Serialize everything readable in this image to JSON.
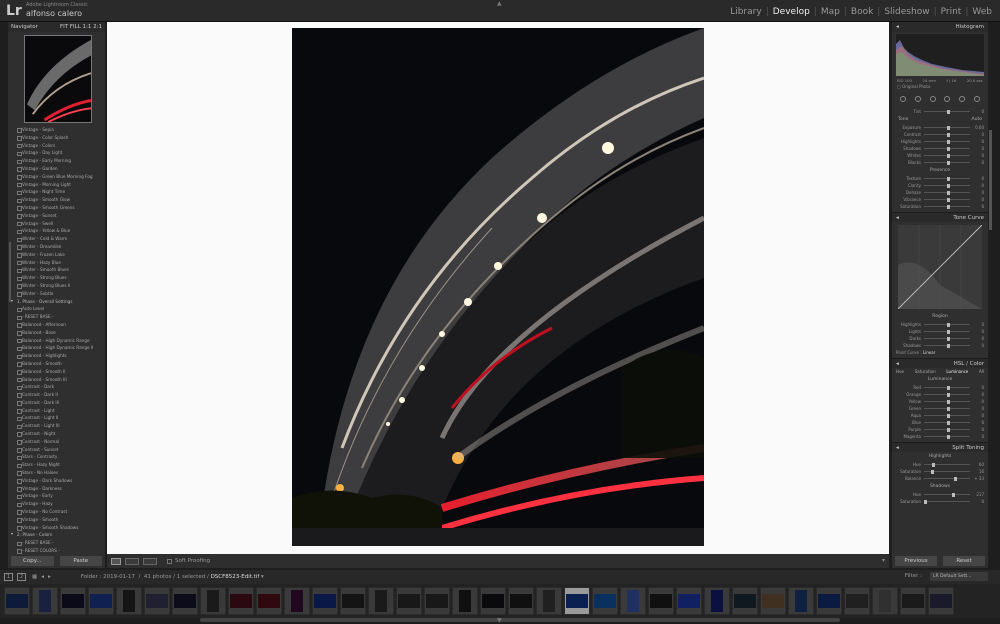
{
  "app": {
    "logo": "Lr",
    "name": "Adobe Lightroom Classic",
    "user": "alfonso calero"
  },
  "modules": [
    "Library",
    "Develop",
    "Map",
    "Book",
    "Slideshow",
    "Print",
    "Web"
  ],
  "active_module": "Develop",
  "navigator": {
    "title": "Navigator",
    "zoom_options": [
      "FIT",
      "FILL",
      "1:1",
      "2:1"
    ]
  },
  "presets": [
    {
      "label": "Vintage - Sepia",
      "group": false
    },
    {
      "label": "Vintage - Color Splash",
      "group": false
    },
    {
      "label": "Vintage - Colors",
      "group": false
    },
    {
      "label": "Vintage - Day Light",
      "group": false
    },
    {
      "label": "Vintage - Early Morning",
      "group": false
    },
    {
      "label": "Vintage - Garden",
      "group": false
    },
    {
      "label": "Vintage - Green Blue Morning Fog",
      "group": false
    },
    {
      "label": "Vintage - Morning Light",
      "group": false
    },
    {
      "label": "Vintage - Night Time",
      "group": false
    },
    {
      "label": "Vintage - Smooth Glow",
      "group": false
    },
    {
      "label": "Vintage - Smooth Greens",
      "group": false
    },
    {
      "label": "Vintage - Sunset",
      "group": false
    },
    {
      "label": "Vintage - Swell",
      "group": false
    },
    {
      "label": "Vintage - Yellow & Blue",
      "group": false
    },
    {
      "label": "Winter - Cold & Warm",
      "group": false
    },
    {
      "label": "Winter - Dreamlike",
      "group": false
    },
    {
      "label": "Winter - Frozen Lake",
      "group": false
    },
    {
      "label": "Winter - Hazy Blue",
      "group": false
    },
    {
      "label": "Winter - Smooth Blues",
      "group": false
    },
    {
      "label": "Winter - Strong Blues",
      "group": false
    },
    {
      "label": "Winter - Strong Blues II",
      "group": false
    },
    {
      "label": "Winter - Subtle",
      "group": false
    },
    {
      "label": "1. Phase - Overall Settings",
      "group": true
    },
    {
      "label": "Auto Level",
      "group": false
    },
    {
      "label": "- RESET BASE -",
      "group": false
    },
    {
      "label": "Balanced - Afternoon",
      "group": false
    },
    {
      "label": "Balanced - Base",
      "group": false
    },
    {
      "label": "Balanced - High Dynamic Range",
      "group": false
    },
    {
      "label": "Balanced - High Dynamic Range II",
      "group": false
    },
    {
      "label": "Balanced - Highlights",
      "group": false
    },
    {
      "label": "Balanced - Smooth",
      "group": false
    },
    {
      "label": "Balanced - Smooth II",
      "group": false
    },
    {
      "label": "Balanced - Smooth III",
      "group": false
    },
    {
      "label": "Contrast - Dark",
      "group": false
    },
    {
      "label": "Contrast - Dark II",
      "group": false
    },
    {
      "label": "Contrast - Dark III",
      "group": false
    },
    {
      "label": "Contrast - Light",
      "group": false
    },
    {
      "label": "Contrast - Light II",
      "group": false
    },
    {
      "label": "Contrast - Light III",
      "group": false
    },
    {
      "label": "Contrast - Night",
      "group": false
    },
    {
      "label": "Contrast - Normal",
      "group": false
    },
    {
      "label": "Contrast - Sunset",
      "group": false
    },
    {
      "label": "Stars - Contrasty",
      "group": false
    },
    {
      "label": "Stars - Hazy Night",
      "group": false
    },
    {
      "label": "Stars - No Haloes",
      "group": false
    },
    {
      "label": "Vintage - Dark Shadows",
      "group": false
    },
    {
      "label": "Vintage - Darkness",
      "group": false
    },
    {
      "label": "Vintage - Early",
      "group": false
    },
    {
      "label": "Vintage - Hazy",
      "group": false
    },
    {
      "label": "Vintage - No Contrast",
      "group": false
    },
    {
      "label": "Vintage - Smooth",
      "group": false
    },
    {
      "label": "Vintage - Smooth Shadows",
      "group": false
    },
    {
      "label": "2. Phase - Colors",
      "group": true
    },
    {
      "label": "- RESET BASE -",
      "group": false
    },
    {
      "label": "- RESET COLORS -",
      "group": false
    }
  ],
  "left_buttons": {
    "copy": "Copy...",
    "paste": "Paste"
  },
  "toolbar": {
    "soft_proofing": "Soft Proofing"
  },
  "right_panel": {
    "histogram_title": "Histogram",
    "histogram_meta": [
      "ISO 100",
      "24 mm",
      "f / 16",
      "20.0 sec"
    ],
    "original_photo": "Original Photo",
    "wb_label": "Tint",
    "tone_title": "Tone",
    "tone_auto": "Auto",
    "tone_sliders": [
      {
        "label": "Exposure",
        "value": "0.00",
        "pos": 0.5
      },
      {
        "label": "Contrast",
        "value": "0",
        "pos": 0.5
      },
      {
        "label": "Highlights",
        "value": "0",
        "pos": 0.5
      },
      {
        "label": "Shadows",
        "value": "0",
        "pos": 0.5
      },
      {
        "label": "Whites",
        "value": "0",
        "pos": 0.5
      },
      {
        "label": "Blacks",
        "value": "0",
        "pos": 0.5
      }
    ],
    "presence_title": "Presence",
    "presence_sliders": [
      {
        "label": "Texture",
        "value": "0",
        "pos": 0.5
      },
      {
        "label": "Clarity",
        "value": "0",
        "pos": 0.5
      },
      {
        "label": "Dehaze",
        "value": "0",
        "pos": 0.5
      },
      {
        "label": "Vibrance",
        "value": "0",
        "pos": 0.5
      },
      {
        "label": "Saturation",
        "value": "0",
        "pos": 0.5
      }
    ],
    "tone_curve_title": "Tone Curve",
    "region_title": "Region",
    "region_sliders": [
      {
        "label": "Highlights",
        "value": "0",
        "pos": 0.5
      },
      {
        "label": "Lights",
        "value": "0",
        "pos": 0.5
      },
      {
        "label": "Darks",
        "value": "0",
        "pos": 0.5
      },
      {
        "label": "Shadows",
        "value": "0",
        "pos": 0.5
      }
    ],
    "point_curve_label": "Point Curve :",
    "point_curve_value": "Linear",
    "hsl_title": "HSL / Color",
    "hsl_tabs": [
      "Hue",
      "Saturation",
      "Luminance",
      "All"
    ],
    "hsl_active": "Luminance",
    "luminance_title": "Luminance",
    "luminance_sliders": [
      {
        "label": "Red",
        "value": "0",
        "pos": 0.5
      },
      {
        "label": "Orange",
        "value": "0",
        "pos": 0.5
      },
      {
        "label": "Yellow",
        "value": "0",
        "pos": 0.5
      },
      {
        "label": "Green",
        "value": "0",
        "pos": 0.5
      },
      {
        "label": "Aqua",
        "value": "0",
        "pos": 0.5
      },
      {
        "label": "Blue",
        "value": "0",
        "pos": 0.5
      },
      {
        "label": "Purple",
        "value": "0",
        "pos": 0.5
      },
      {
        "label": "Magenta",
        "value": "0",
        "pos": 0.5
      }
    ],
    "split_title": "Split Toning",
    "split_highlights": "Highlights",
    "split_highlight_sliders": [
      {
        "label": "Hue",
        "value": "60",
        "pos": 0.17
      },
      {
        "label": "Saturation",
        "value": "16",
        "pos": 0.16
      }
    ],
    "split_balance": {
      "label": "Balance",
      "value": "+ 33",
      "pos": 0.66
    },
    "split_shadows": "Shadows",
    "split_shadow_sliders": [
      {
        "label": "Hue",
        "value": "217",
        "pos": 0.6
      },
      {
        "label": "Saturation",
        "value": "0",
        "pos": 0.0
      }
    ]
  },
  "right_buttons": {
    "previous": "Previous",
    "reset": "Reset"
  },
  "filmstrip_bar": {
    "page_1": "1",
    "page_2": "2",
    "folder": "Folder : 2019-01-17",
    "count": "41 photos / 1 selected /",
    "filename": "DSCF8523-Edit.tif",
    "filter_label": "Filter :",
    "filter_value": "LR Default Sett..."
  },
  "colors": {
    "panel": "#2f2f2f",
    "background": "#1e1e1e",
    "canvas": "#fafafa",
    "accent": "#eeeeee"
  }
}
